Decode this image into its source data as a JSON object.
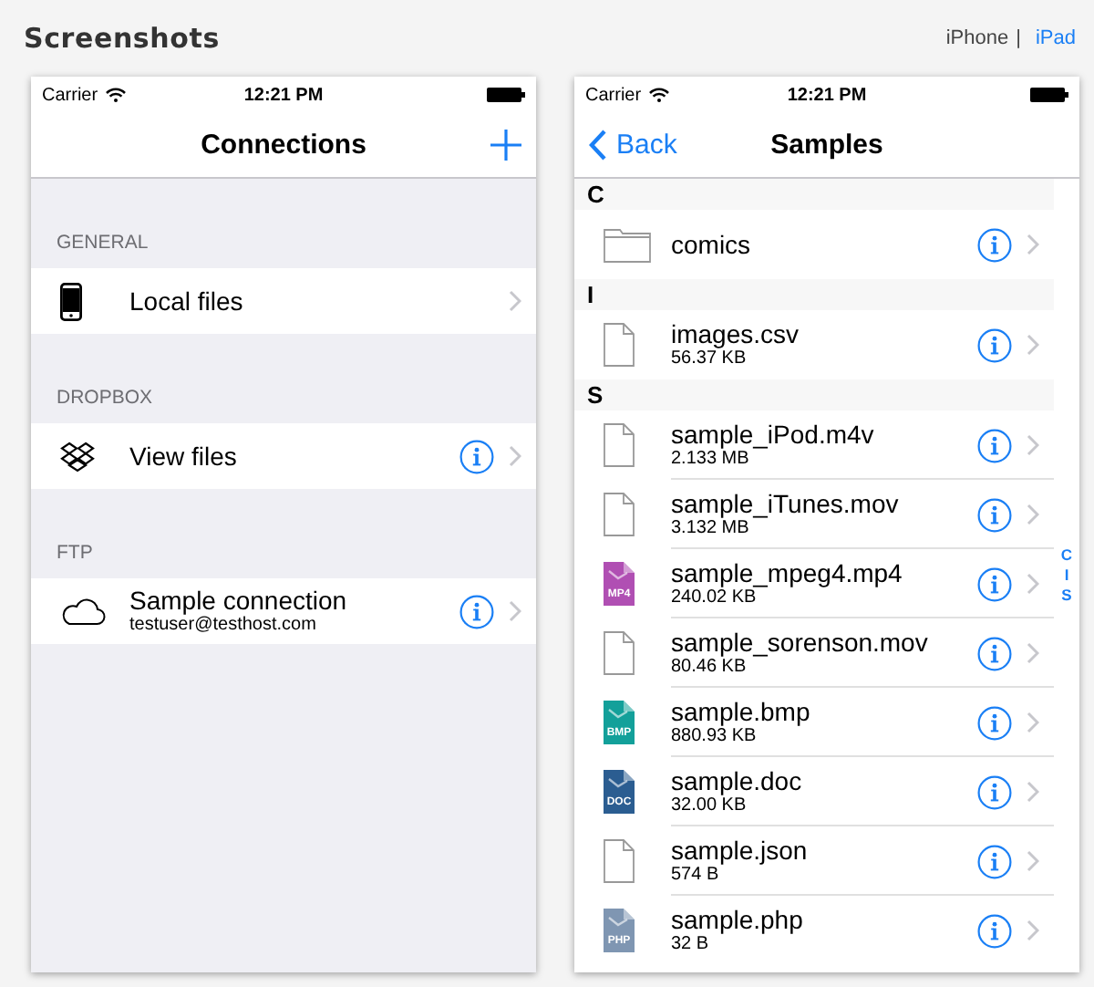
{
  "header": {
    "title": "Screenshots",
    "separator": "|",
    "devices": [
      {
        "label": "iPhone",
        "selected": false
      },
      {
        "label": "iPad",
        "selected": true
      }
    ]
  },
  "left_screen": {
    "status_bar": {
      "carrier": "Carrier",
      "time": "12:21 PM"
    },
    "nav": {
      "title": "Connections"
    },
    "sections": [
      {
        "header": "GENERAL",
        "rows": [
          {
            "kind": "phone",
            "label": "Local files",
            "info": false
          }
        ]
      },
      {
        "header": "DROPBOX",
        "rows": [
          {
            "kind": "dropbox",
            "label": "View files",
            "info": true
          }
        ]
      },
      {
        "header": "FTP",
        "rows": [
          {
            "kind": "cloud",
            "label": "Sample connection",
            "detail": "testuser@testhost.com",
            "info": true
          }
        ]
      }
    ]
  },
  "right_screen": {
    "status_bar": {
      "carrier": "Carrier",
      "time": "12:21 PM"
    },
    "nav": {
      "back": "Back",
      "title": "Samples"
    },
    "sections": [
      {
        "letter": "C",
        "rows": [
          {
            "kind": "folder",
            "name": "comics"
          }
        ]
      },
      {
        "letter": "I",
        "rows": [
          {
            "kind": "file",
            "name": "images.csv",
            "size": "56.37 KB"
          }
        ]
      },
      {
        "letter": "S",
        "rows": [
          {
            "kind": "file",
            "name": "sample_iPod.m4v",
            "size": "2.133 MB"
          },
          {
            "kind": "file",
            "name": "sample_iTunes.mov",
            "size": "3.132 MB"
          },
          {
            "kind": "video",
            "name": "sample_mpeg4.mp4",
            "size": "240.02 KB",
            "badge": "MP4"
          },
          {
            "kind": "file",
            "name": "sample_sorenson.mov",
            "size": "80.46 KB"
          },
          {
            "kind": "image",
            "name": "sample.bmp",
            "size": "880.93 KB",
            "badge": "BMP"
          },
          {
            "kind": "document",
            "name": "sample.doc",
            "size": "32.00 KB",
            "badge": "DOC"
          },
          {
            "kind": "file",
            "name": "sample.json",
            "size": "574 B"
          },
          {
            "kind": "script",
            "name": "sample.php",
            "size": "32 B",
            "badge": "PHP"
          }
        ]
      }
    ],
    "index": [
      "C",
      "I",
      "S"
    ]
  }
}
